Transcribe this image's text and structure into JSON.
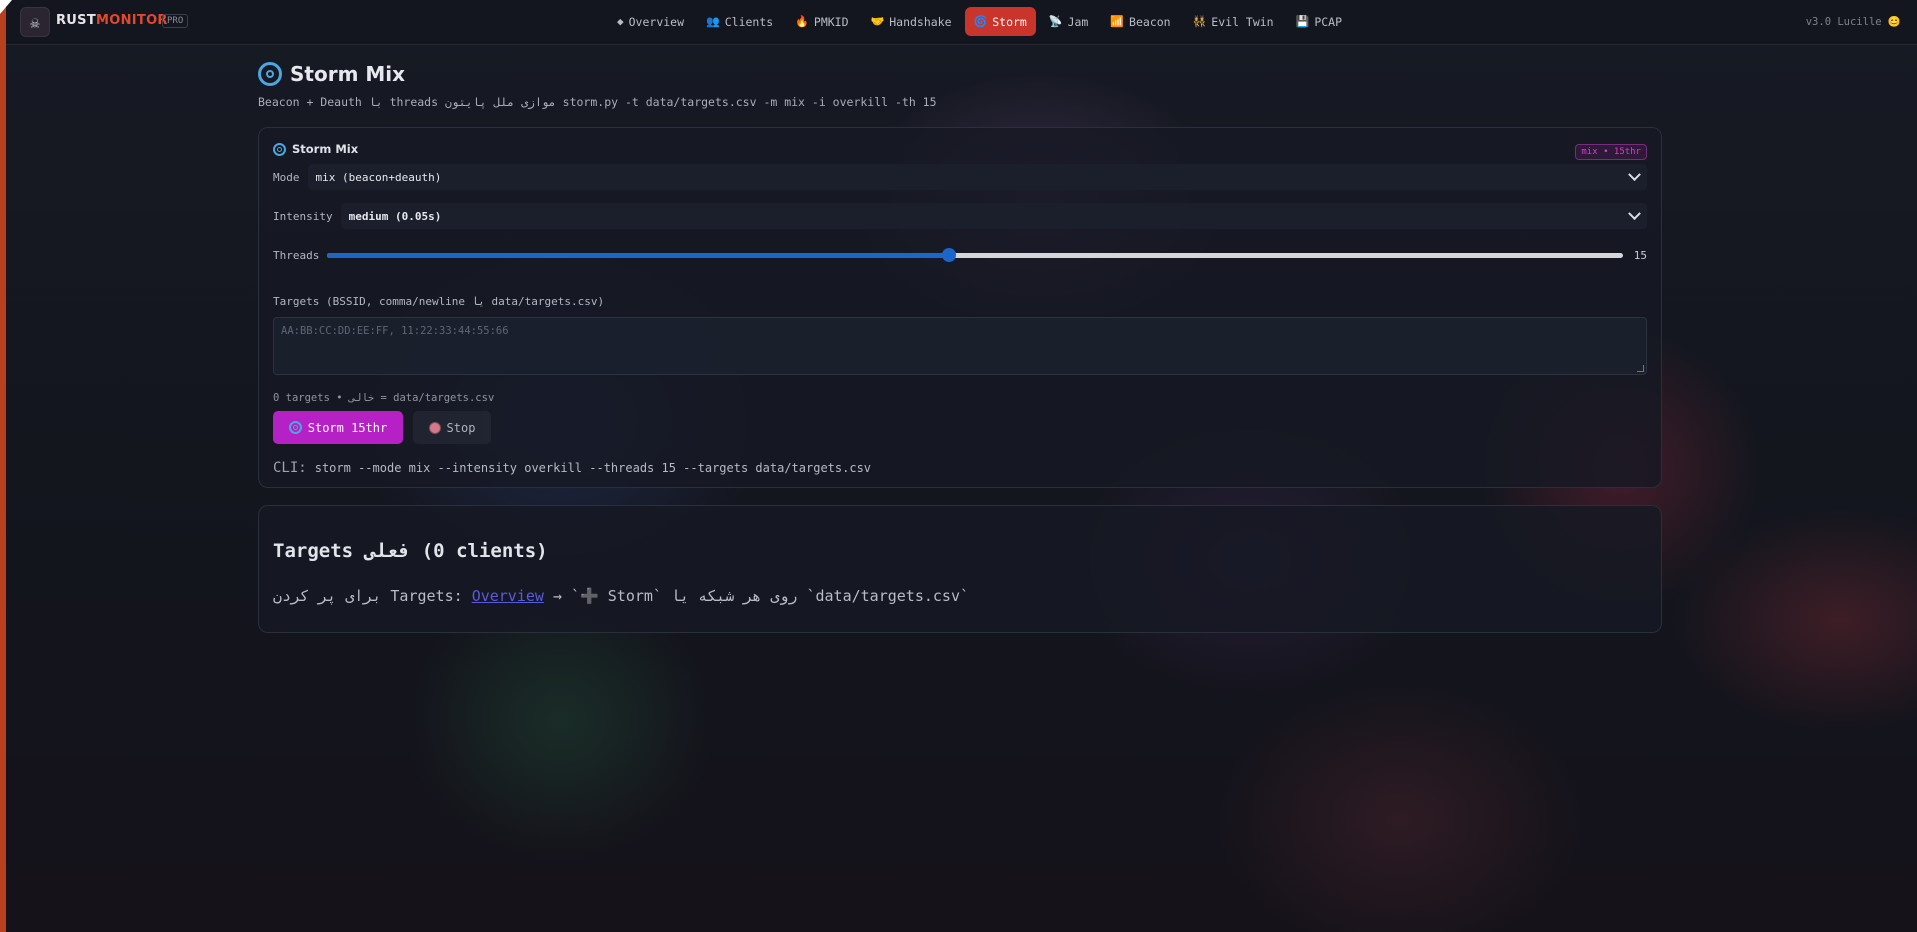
{
  "app": {
    "brand_rust": "RUST",
    "brand_monitor": "MONITOR",
    "tier": "PRO",
    "version": "v3.0 Lucille 😊"
  },
  "nav": [
    {
      "icon": "◆",
      "label": "Overview"
    },
    {
      "icon": "👥",
      "label": "Clients"
    },
    {
      "icon": "🔥",
      "label": "PMKID"
    },
    {
      "icon": "🤝",
      "label": "Handshake"
    },
    {
      "icon": "🌀",
      "label": "Storm",
      "active": true
    },
    {
      "icon": "📡",
      "label": "Jam"
    },
    {
      "icon": "📶",
      "label": "Beacon"
    },
    {
      "icon": "👯",
      "label": "Evil Twin"
    },
    {
      "icon": "💾",
      "label": "PCAP"
    }
  ],
  "page": {
    "title": "Storm Mix",
    "subtitle": "Beacon + Deauth با threads موازی ملل پایتون storm.py -t data/targets.csv -m mix -i overkill -th 15"
  },
  "storm_card": {
    "title": "Storm Mix",
    "badge": "mix • 15thr",
    "mode_label": "Mode",
    "mode_value": "mix (beacon+deauth)",
    "intensity_label": "Intensity",
    "intensity_value": "medium (0.05s)",
    "threads_label": "Threads",
    "threads_value": "15",
    "threads_fraction": 0.48,
    "targets_label": "Targets (BSSID, comma/newline یا data/targets.csv)",
    "targets_placeholder": "AA:BB:CC:DD:EE:FF, 11:22:33:44:55:66",
    "targets_count": "0 targets • خالی = data/targets.csv",
    "storm_button": "Storm 15thr",
    "stop_button": "Stop",
    "cli_label": "CLI:",
    "cli_command": "storm --mode mix --intensity overkill --threads 15 --targets data/targets.csv"
  },
  "targets_card": {
    "title": "Targets فعلی (0 clients)",
    "text_prefix": "برای پر کردن Targets: ",
    "link": "Overview",
    "text_suffix": " → `➕ Storm` روی هر شبکه یا `data/targets.csv`"
  },
  "colors": {
    "accent_active": "#c9352a",
    "storm_button": "#b521c4",
    "slider": "#1b66c8",
    "brand_red": "#e0492b"
  }
}
